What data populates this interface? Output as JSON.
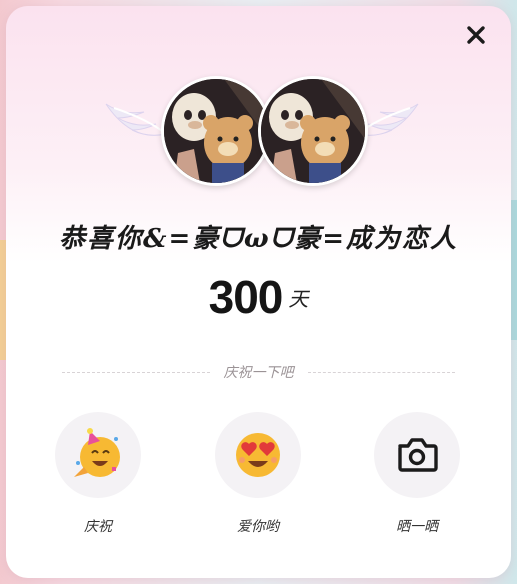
{
  "dialog": {
    "headline": "恭喜你&=豪ᗜωᗜ豪=成为恋人",
    "days_value": "300",
    "days_unit": "天",
    "divider_text": "庆祝一下吧"
  },
  "actions": [
    {
      "label": "庆祝",
      "icon": "party-emoji-icon"
    },
    {
      "label": "爱你哟",
      "icon": "heart-eyes-emoji-icon"
    },
    {
      "label": "晒一晒",
      "icon": "camera-icon"
    }
  ],
  "colors": {
    "card_top": "#fbe2ef",
    "card_bottom": "#ffffff",
    "action_bg": "#f4f2f5",
    "text": "#1a1a1a",
    "muted": "#9b9396"
  }
}
